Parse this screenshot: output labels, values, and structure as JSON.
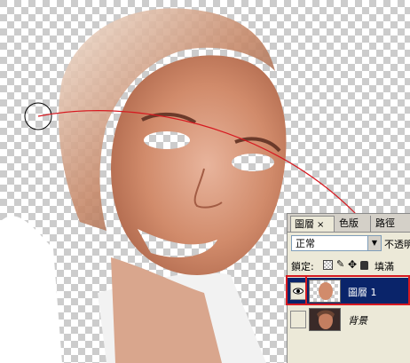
{
  "layers_panel": {
    "tabs": [
      {
        "label": "圖層"
      },
      {
        "label": "色版"
      },
      {
        "label": "路徑"
      }
    ],
    "tab_close_glyph": "×",
    "blend_mode": "正常",
    "opacity_label": "不透明",
    "lock_label": "鎖定:",
    "fill_label": "填滿",
    "layers": [
      {
        "name": "圖層 1",
        "selected": true,
        "visible": true
      },
      {
        "name": "背景",
        "selected": false,
        "visible": false
      }
    ]
  },
  "icons": {
    "visibility": "eye-icon",
    "lock_transparent": "checker-icon",
    "lock_paint": "brush-icon",
    "lock_move": "move-icon",
    "lock_all": "padlock-icon",
    "dropdown": "triangle-down-icon"
  },
  "colors": {
    "selection_highlight": "#0a246a",
    "annotation_red": "#d71920",
    "panel_bg": "#ece9d8"
  }
}
